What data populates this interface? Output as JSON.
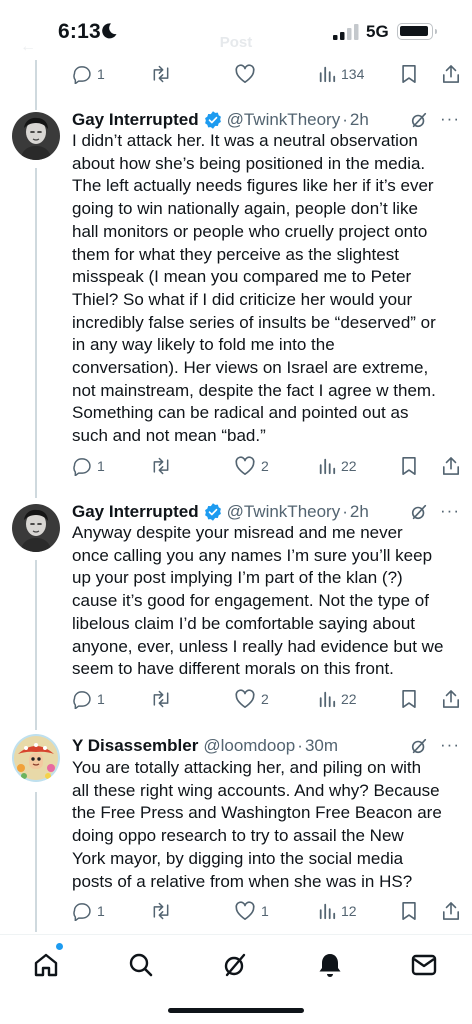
{
  "status_bar": {
    "time": "6:13",
    "network": "5G",
    "faint_title": "Post"
  },
  "tweets": [
    {
      "name": "Gay Interrupted",
      "handle": "@TwinkTheory",
      "time": "2h",
      "verified": true,
      "lines": [
        "I didn’t attack her. It was a neutral observation",
        "about how she’s being positioned in the media.",
        "The left actually needs figures like her if it’s ever",
        "going to win nationally again, people don’t like",
        "hall monitors or people who cruelly project onto",
        "them for what they perceive as the slightest",
        "misspeak (I mean you compared me to Peter",
        "Thiel? So what if I did criticize her would your",
        "incredibly false series of insults be “deserved” or",
        "in any way likely to fold me into the",
        "conversation). Her views on Israel are extreme,",
        "not mainstream, despite the fact I agree w them.",
        "Something can be radical and pointed out as",
        "such and not mean “bad.”"
      ],
      "replies": "1",
      "likes": "2",
      "views": "22"
    },
    {
      "name": "Gay Interrupted",
      "handle": "@TwinkTheory",
      "time": "2h",
      "verified": true,
      "lines": [
        "Anyway despite your misread and me never",
        "once calling you any names I’m sure you’ll keep",
        "up your post implying I’m part of the klan (?)",
        "cause it’s good for engagement. Not the type of",
        "libelous claim I’d be comfortable saying about",
        "anyone, ever, unless I really had evidence but we",
        "seem to have different morals on this front."
      ],
      "replies": "1",
      "likes": "2",
      "views": "22"
    },
    {
      "name": "Y Disassembler",
      "handle": "@loomdoop",
      "time": "30m",
      "verified": false,
      "lines": [
        "You are totally attacking her, and piling on with",
        "all these right wing accounts. And why? Because",
        "the Free Press and Washington Free Beacon are",
        "doing oppo research to try to assail the New",
        "York mayor, by digging into the social media",
        "posts of a relative from when she was in HS?"
      ],
      "replies": "1",
      "likes": "1",
      "views": "12"
    }
  ],
  "top_actions": {
    "replies": "1",
    "views": "134"
  },
  "separator": "·",
  "colors": {
    "accent": "#1d9bf0",
    "secondary_text": "#536471",
    "thread_line": "#cfd9de"
  },
  "nav": [
    "home-icon",
    "search-icon",
    "grok-icon",
    "notifications-icon",
    "messages-icon"
  ]
}
